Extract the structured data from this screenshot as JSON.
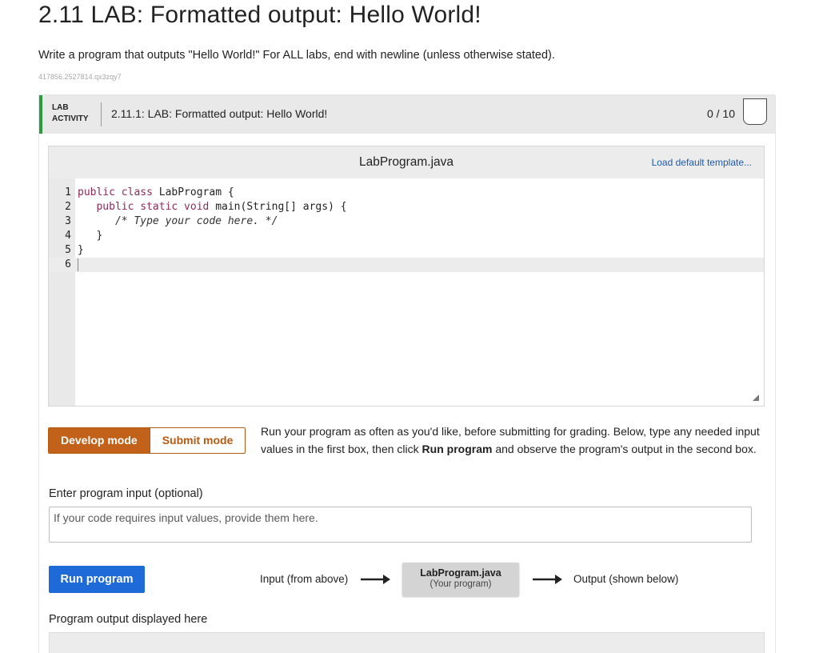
{
  "page": {
    "title": "2.11 LAB: Formatted output: Hello World!",
    "description": "Write a program that outputs \"Hello World!\" For ALL labs, end with newline (unless otherwise stated).",
    "id_code": "417856.2527814.qx3zqy7"
  },
  "lab": {
    "tag_line1": "LAB",
    "tag_line2": "ACTIVITY",
    "name": "2.11.1: LAB: Formatted output: Hello World!",
    "score": "0 / 10",
    "accent_color": "#2c9a3f"
  },
  "editor": {
    "filename": "LabProgram.java",
    "load_template": "Load default template...",
    "lines": [
      {
        "n": "1",
        "kw": "public class ",
        "rest": "LabProgram {"
      },
      {
        "n": "2",
        "kw": "   public static void ",
        "rest": "main(String[] args) {"
      },
      {
        "n": "3",
        "comment": "      /* Type your code here. */"
      },
      {
        "n": "4",
        "plain": "   }"
      },
      {
        "n": "5",
        "plain": "}"
      },
      {
        "n": "6",
        "plain": ""
      }
    ]
  },
  "modes": {
    "develop": "Develop mode",
    "submit": "Submit mode",
    "help_before": "Run your program as often as you'd like, before submitting for grading. Below, type any needed input values in the first box, then click ",
    "help_bold": "Run program",
    "help_after": " and observe the program's output in the second box."
  },
  "input": {
    "label": "Enter program input (optional)",
    "placeholder": "If your code requires input values, provide them here."
  },
  "run": {
    "button": "Run program",
    "flow_input": "Input (from above)",
    "program_name": "LabProgram.java",
    "program_sub": "(Your program)",
    "flow_output": "Output (shown below)",
    "color": "#1f6ad9"
  },
  "output": {
    "label": "Program output displayed here"
  }
}
